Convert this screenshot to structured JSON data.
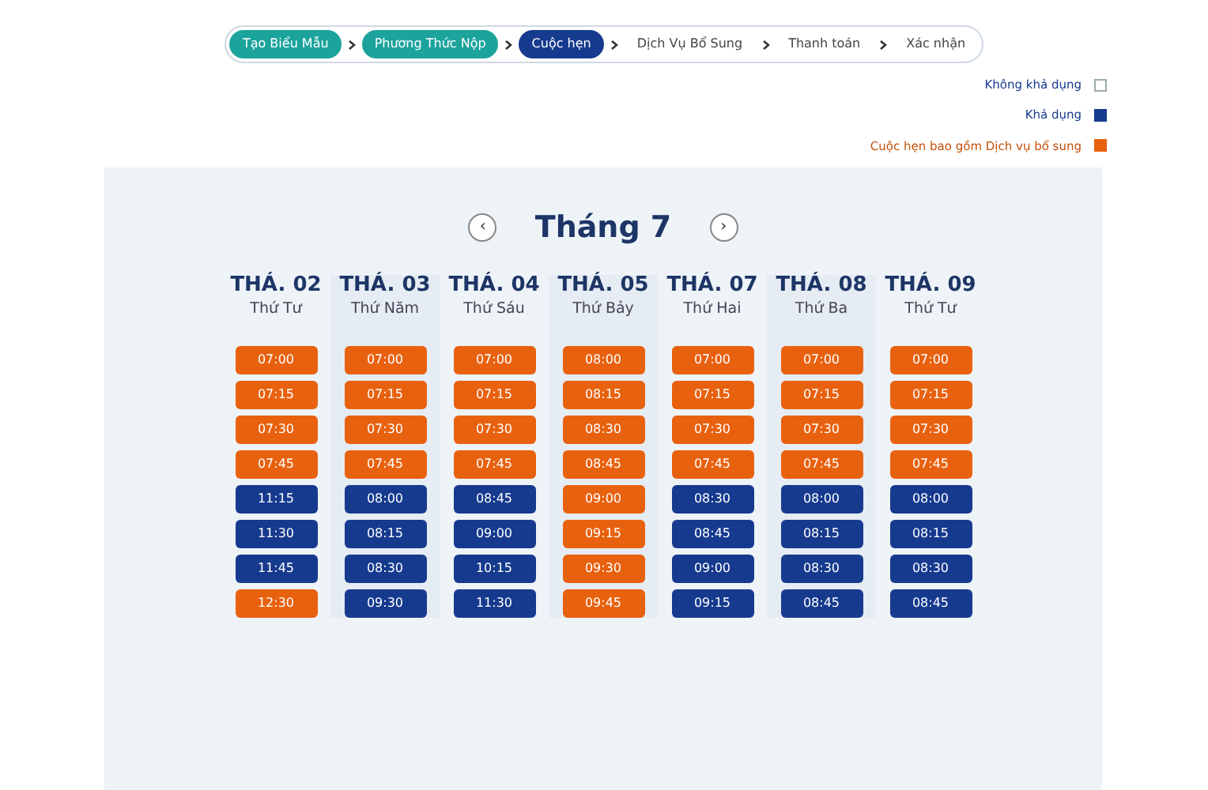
{
  "steps": [
    {
      "label": "Tạo Biểu Mẫu",
      "kind": "done"
    },
    {
      "label": "Phương Thức Nộp",
      "kind": "done"
    },
    {
      "label": "Cuộc hẹn",
      "kind": "current"
    },
    {
      "label": "Dịch Vụ Bổ Sung",
      "kind": "pending"
    },
    {
      "label": "Thanh toán",
      "kind": "pending"
    },
    {
      "label": "Xác nhận",
      "kind": "pending"
    }
  ],
  "legend": [
    {
      "label": "Không khả dụng",
      "color": "#ffffff"
    },
    {
      "label": "Khả dụng",
      "color": "#163a8e"
    },
    {
      "label": "Cuộc hẹn bao gồm Dịch vụ bổ sung",
      "color": "#e8610f"
    }
  ],
  "calendar": {
    "month": "Tháng 7",
    "prev": "‹",
    "next": "›",
    "days": [
      {
        "date": "THÁ. 02",
        "weekday": "Thứ Tư",
        "slots": [
          {
            "time": "07:00",
            "kind": "extra"
          },
          {
            "time": "07:15",
            "kind": "extra"
          },
          {
            "time": "07:30",
            "kind": "extra"
          },
          {
            "time": "07:45",
            "kind": "extra"
          },
          {
            "time": "11:15",
            "kind": "available"
          },
          {
            "time": "11:30",
            "kind": "available"
          },
          {
            "time": "11:45",
            "kind": "available"
          },
          {
            "time": "12:30",
            "kind": "extra"
          }
        ]
      },
      {
        "date": "THÁ. 03",
        "weekday": "Thứ Năm",
        "slots": [
          {
            "time": "07:00",
            "kind": "extra"
          },
          {
            "time": "07:15",
            "kind": "extra"
          },
          {
            "time": "07:30",
            "kind": "extra"
          },
          {
            "time": "07:45",
            "kind": "extra"
          },
          {
            "time": "08:00",
            "kind": "available"
          },
          {
            "time": "08:15",
            "kind": "available"
          },
          {
            "time": "08:30",
            "kind": "available"
          },
          {
            "time": "09:30",
            "kind": "available"
          }
        ]
      },
      {
        "date": "THÁ. 04",
        "weekday": "Thứ Sáu",
        "slots": [
          {
            "time": "07:00",
            "kind": "extra"
          },
          {
            "time": "07:15",
            "kind": "extra"
          },
          {
            "time": "07:30",
            "kind": "extra"
          },
          {
            "time": "07:45",
            "kind": "extra"
          },
          {
            "time": "08:45",
            "kind": "available"
          },
          {
            "time": "09:00",
            "kind": "available"
          },
          {
            "time": "10:15",
            "kind": "available"
          },
          {
            "time": "11:30",
            "kind": "available"
          }
        ]
      },
      {
        "date": "THÁ. 05",
        "weekday": "Thứ Bảy",
        "slots": [
          {
            "time": "08:00",
            "kind": "extra"
          },
          {
            "time": "08:15",
            "kind": "extra"
          },
          {
            "time": "08:30",
            "kind": "extra"
          },
          {
            "time": "08:45",
            "kind": "extra"
          },
          {
            "time": "09:00",
            "kind": "extra"
          },
          {
            "time": "09:15",
            "kind": "extra"
          },
          {
            "time": "09:30",
            "kind": "extra"
          },
          {
            "time": "09:45",
            "kind": "extra"
          }
        ]
      },
      {
        "date": "THÁ. 07",
        "weekday": "Thứ Hai",
        "slots": [
          {
            "time": "07:00",
            "kind": "extra"
          },
          {
            "time": "07:15",
            "kind": "extra"
          },
          {
            "time": "07:30",
            "kind": "extra"
          },
          {
            "time": "07:45",
            "kind": "extra"
          },
          {
            "time": "08:30",
            "kind": "available"
          },
          {
            "time": "08:45",
            "kind": "available"
          },
          {
            "time": "09:00",
            "kind": "available"
          },
          {
            "time": "09:15",
            "kind": "available"
          }
        ]
      },
      {
        "date": "THÁ. 08",
        "weekday": "Thứ Ba",
        "slots": [
          {
            "time": "07:00",
            "kind": "extra"
          },
          {
            "time": "07:15",
            "kind": "extra"
          },
          {
            "time": "07:30",
            "kind": "extra"
          },
          {
            "time": "07:45",
            "kind": "extra"
          },
          {
            "time": "08:00",
            "kind": "available"
          },
          {
            "time": "08:15",
            "kind": "available"
          },
          {
            "time": "08:30",
            "kind": "available"
          },
          {
            "time": "08:45",
            "kind": "available"
          }
        ]
      },
      {
        "date": "THÁ. 09",
        "weekday": "Thứ Tư",
        "slots": [
          {
            "time": "07:00",
            "kind": "extra"
          },
          {
            "time": "07:15",
            "kind": "extra"
          },
          {
            "time": "07:30",
            "kind": "extra"
          },
          {
            "time": "07:45",
            "kind": "extra"
          },
          {
            "time": "08:00",
            "kind": "available"
          },
          {
            "time": "08:15",
            "kind": "available"
          },
          {
            "time": "08:30",
            "kind": "available"
          },
          {
            "time": "08:45",
            "kind": "available"
          }
        ]
      }
    ]
  }
}
